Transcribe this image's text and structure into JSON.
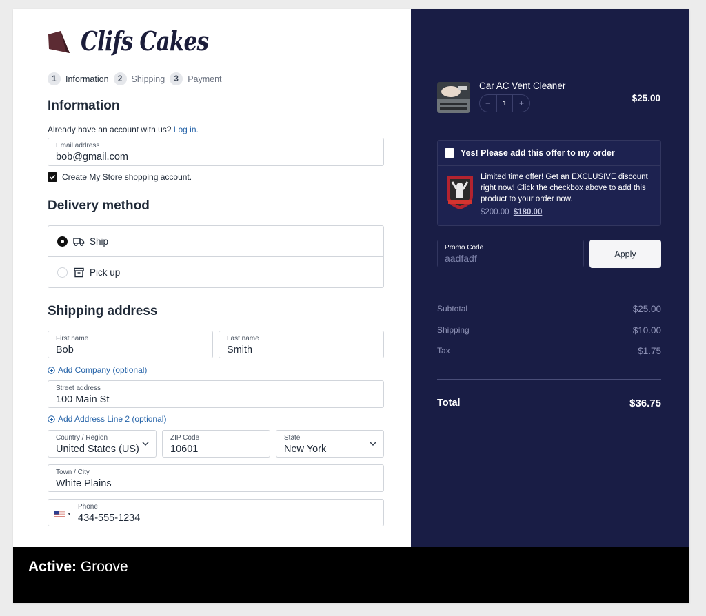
{
  "brand": {
    "name": "Clifs Cakes",
    "logo_icon": "cake-slice-icon",
    "logo_color": "#5c2b33"
  },
  "steps": [
    {
      "number": "1",
      "label": "Information"
    },
    {
      "number": "2",
      "label": "Shipping"
    },
    {
      "number": "3",
      "label": "Payment"
    }
  ],
  "information": {
    "heading": "Information",
    "account_prompt": "Already have an account with us?",
    "login_link": "Log in.",
    "email_label": "Email address",
    "email_value": "bob@gmail.com",
    "create_account_label": "Create My Store shopping account.",
    "create_account_checked": true
  },
  "delivery": {
    "heading": "Delivery method",
    "options": [
      {
        "label": "Ship",
        "icon": "truck-icon",
        "selected": true
      },
      {
        "label": "Pick up",
        "icon": "store-icon",
        "selected": false
      }
    ]
  },
  "shipping": {
    "heading": "Shipping address",
    "first_name_label": "First name",
    "first_name_value": "Bob",
    "last_name_label": "Last name",
    "last_name_value": "Smith",
    "add_company": "Add Company (optional)",
    "street_label": "Street address",
    "street_value": "100 Main St",
    "add_line2": "Add Address Line 2 (optional)",
    "country_label": "Country / Region",
    "country_value": "United States (US)",
    "zip_label": "ZIP Code",
    "zip_value": "10601",
    "state_label": "State",
    "state_value": "New York",
    "city_label": "Town / City",
    "city_value": "White Plains",
    "phone_label": "Phone",
    "phone_value": "434-555-1234",
    "phone_flag_icon": "us-flag-icon"
  },
  "cart": {
    "product_name": "Car AC Vent Cleaner",
    "quantity": "1",
    "qty_minus": "−",
    "qty_plus": "+",
    "price": "$25.00"
  },
  "offer": {
    "checkbox_label": "Yes! Please add this offer to my order",
    "text": "Limited time offer! Get an EXCLUSIVE discount right now! Click the checkbox above to add this product to your order now.",
    "old_price": "$200.00",
    "new_price": "$180.00"
  },
  "promo": {
    "label": "Promo Code",
    "value": "aadfadf",
    "apply_label": "Apply"
  },
  "summary": {
    "subtotal_label": "Subtotal",
    "subtotal_value": "$25.00",
    "shipping_label": "Shipping",
    "shipping_value": "$10.00",
    "tax_label": "Tax",
    "tax_value": "$1.75",
    "total_label": "Total",
    "total_value": "$36.75"
  },
  "footer": {
    "active_label": "Active:",
    "active_value": "Groove"
  },
  "colors": {
    "sidebar_bg": "#191d45",
    "link": "#2563a8",
    "footer_bg": "#000000"
  }
}
